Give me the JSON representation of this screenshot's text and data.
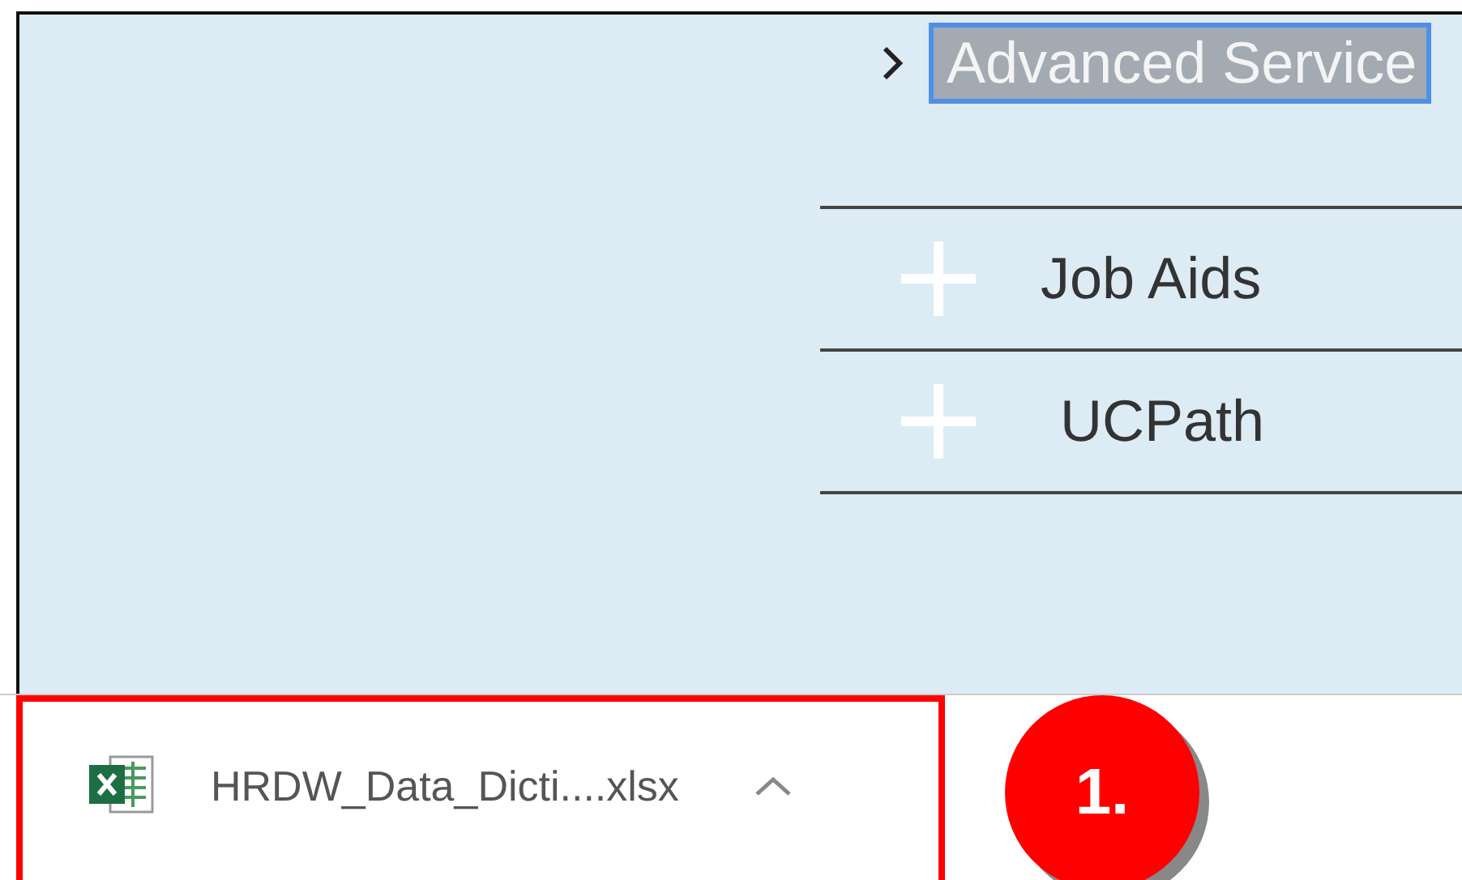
{
  "nav_link": {
    "label": "Advanced Service",
    "selected": true
  },
  "accordion": [
    {
      "label": "Job Aids",
      "expanded": false
    },
    {
      "label": "UCPath",
      "expanded": false
    }
  ],
  "download_bar": {
    "file_name": "HRDW_Data_Dicti....xlsx",
    "highlighted": true
  },
  "annotation": {
    "label": "1."
  }
}
